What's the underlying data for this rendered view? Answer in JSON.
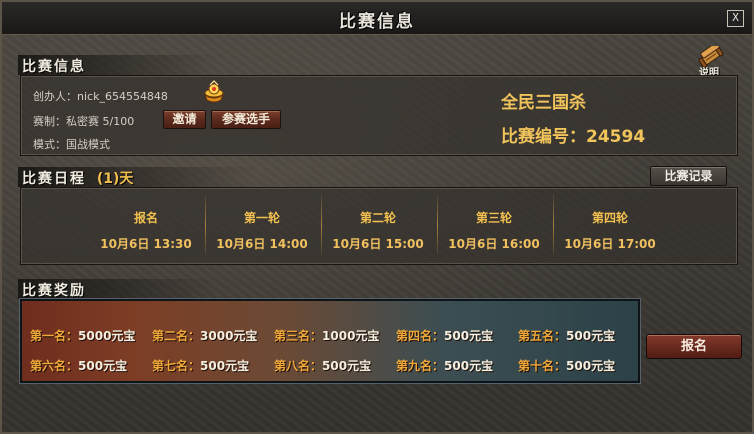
{
  "window": {
    "title": "比赛信息",
    "close_label": "X"
  },
  "info_section": {
    "title": "比赛信息",
    "help_label": "说明",
    "creator": "创办人：nick_654554848",
    "format": "赛制：私密赛  5/100",
    "mode": "模式：国战模式",
    "invite_label": "邀请",
    "participants_label": "参赛选手",
    "match_name": "全民三国杀",
    "match_id": "比赛编号：24594"
  },
  "schedule_section": {
    "title": "比赛日程",
    "days": "(1)天",
    "record_label": "比赛记录",
    "rounds": [
      {
        "name": "报名",
        "time": "10月6日 13:30"
      },
      {
        "name": "第一轮",
        "time": "10月6日 14:00"
      },
      {
        "name": "第二轮",
        "time": "10月6日 15:00"
      },
      {
        "name": "第三轮",
        "time": "10月6日 16:00"
      },
      {
        "name": "第四轮",
        "time": "10月6日 17:00"
      }
    ]
  },
  "rewards_section": {
    "title": "比赛奖励",
    "rewards": [
      {
        "rank": "第一名：",
        "amount": "5000元宝"
      },
      {
        "rank": "第二名：",
        "amount": "3000元宝"
      },
      {
        "rank": "第三名：",
        "amount": "1000元宝"
      },
      {
        "rank": "第四名：",
        "amount": "500元宝"
      },
      {
        "rank": "第五名：",
        "amount": "500元宝"
      },
      {
        "rank": "第六名：",
        "amount": "500元宝"
      },
      {
        "rank": "第七名：",
        "amount": "500元宝"
      },
      {
        "rank": "第八名：",
        "amount": "500元宝"
      },
      {
        "rank": "第九名：",
        "amount": "500元宝"
      },
      {
        "rank": "第十名：",
        "amount": "500元宝"
      }
    ]
  },
  "signup_label": "报名",
  "colors": {
    "accent_gold": "#f0c35b",
    "reward_rank": "#f1a93a",
    "button_red": "#6a2b1f"
  },
  "icons": {
    "help": "scroll-icon",
    "creator": "gold-ingot-icon"
  }
}
